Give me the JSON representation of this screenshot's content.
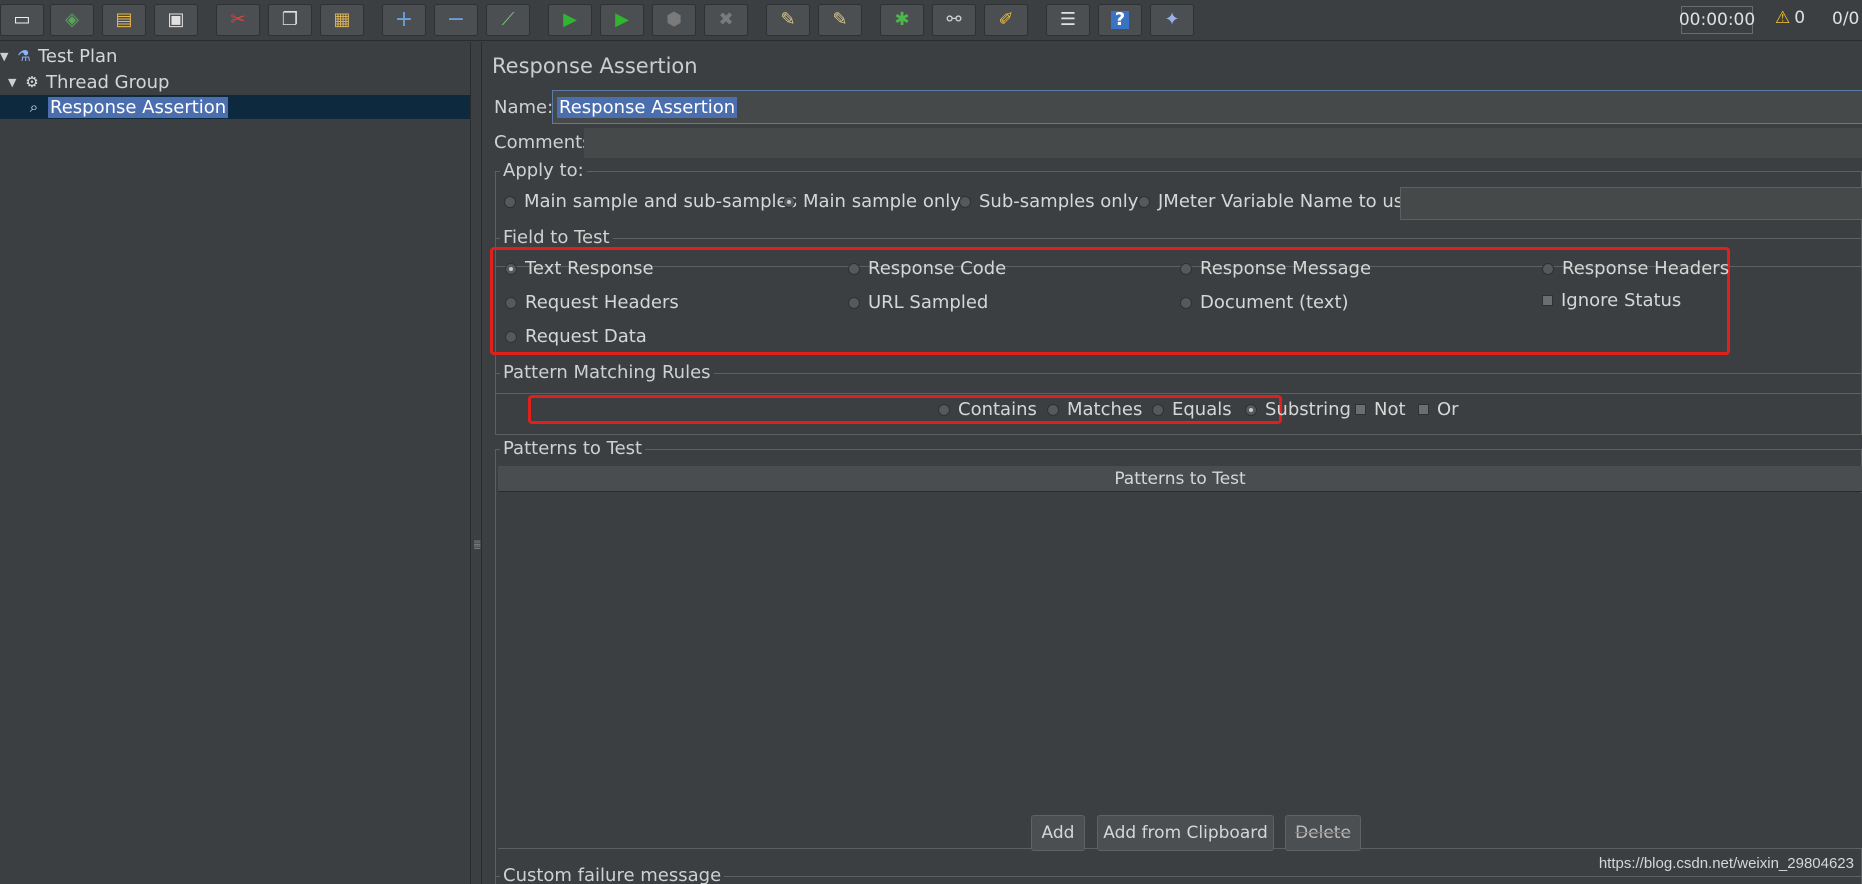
{
  "toolbar": {
    "buttons": [
      {
        "name": "new-icon",
        "glyph": "▭"
      },
      {
        "name": "templates-icon",
        "glyph": "◈"
      },
      {
        "name": "open-icon",
        "glyph": "▤"
      },
      {
        "name": "save-icon",
        "glyph": "▣"
      },
      {
        "name": "cut-icon",
        "glyph": "✂"
      },
      {
        "name": "copy-icon",
        "glyph": "❐"
      },
      {
        "name": "paste-icon",
        "glyph": "▦"
      },
      {
        "name": "expand-icon",
        "glyph": "+"
      },
      {
        "name": "collapse-icon",
        "glyph": "−"
      },
      {
        "name": "toggle-icon",
        "glyph": "⟋"
      },
      {
        "name": "start-icon",
        "glyph": "▶"
      },
      {
        "name": "start-no-pause-icon",
        "glyph": "▶"
      },
      {
        "name": "stop-icon",
        "glyph": "⬢"
      },
      {
        "name": "shutdown-icon",
        "glyph": "✖"
      },
      {
        "name": "clear-icon",
        "glyph": "✎"
      },
      {
        "name": "clear-all-icon",
        "glyph": "✎"
      },
      {
        "name": "debug-icon",
        "glyph": "✱"
      },
      {
        "name": "search-icon",
        "glyph": "⚯"
      },
      {
        "name": "reset-search-icon",
        "glyph": "✐"
      },
      {
        "name": "function-helper-icon",
        "glyph": "☰"
      },
      {
        "name": "help-icon",
        "glyph": "?"
      },
      {
        "name": "remote-icon",
        "glyph": "✦"
      }
    ],
    "timer": "00:00:00",
    "warnings": "0",
    "threads": "0/0"
  },
  "tree": {
    "items": [
      {
        "label": "Test Plan"
      },
      {
        "label": "Thread Group"
      },
      {
        "label": "Response Assertion"
      }
    ]
  },
  "panel": {
    "title": "Response Assertion",
    "name_label": "Name:",
    "name_value": "Response Assertion",
    "comments_label": "Comments:",
    "apply_to": {
      "title": "Apply to:",
      "options": [
        "Main sample and sub-samples",
        "Main sample only",
        "Sub-samples only",
        "JMeter Variable Name to use"
      ],
      "selected": "Main sample only"
    },
    "field_to_test": {
      "title": "Field to Test",
      "options": [
        "Text Response",
        "Response Code",
        "Response Message",
        "Response Headers",
        "Request Headers",
        "URL Sampled",
        "Document (text)",
        "Request Data"
      ],
      "ignore_status": "Ignore Status",
      "selected": "Text Response"
    },
    "pattern_matching": {
      "title": "Pattern Matching Rules",
      "options": [
        "Contains",
        "Matches",
        "Equals",
        "Substring"
      ],
      "checks": [
        "Not",
        "Or"
      ],
      "selected": "Substring"
    },
    "patterns": {
      "title": "Patterns to Test",
      "column": "Patterns to Test",
      "add": "Add",
      "add_clipboard": "Add from Clipboard",
      "delete": "Delete"
    },
    "custom_failure": "Custom failure message"
  },
  "colors": {
    "highlight_box": "#e0201b",
    "selection": "#4b6eaf",
    "background": "#3c3f41"
  },
  "watermark": "https://blog.csdn.net/weixin_29804623"
}
